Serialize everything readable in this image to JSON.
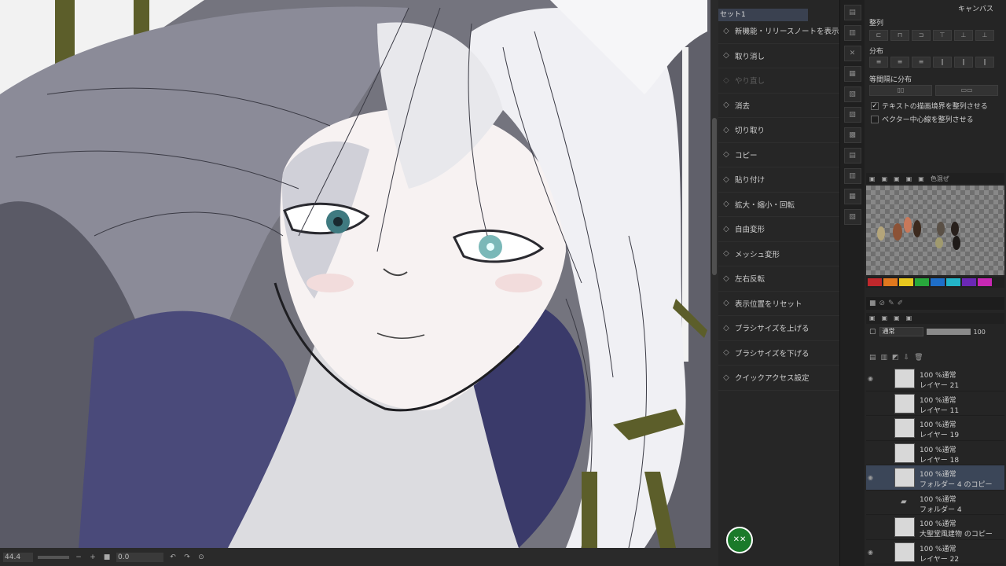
{
  "canvas": {
    "zoom": "44.4",
    "angle": "0.0"
  },
  "menu": {
    "set_tab": "セット1",
    "items": [
      {
        "label": "新機能・リリースノートを表示",
        "icon": "info-icon",
        "disabled": false
      },
      {
        "label": "取り消し",
        "icon": "undo-icon",
        "disabled": false
      },
      {
        "label": "やり直し",
        "icon": "redo-icon",
        "disabled": true
      },
      {
        "label": "消去",
        "icon": "clear-icon",
        "disabled": false
      },
      {
        "label": "切り取り",
        "icon": "cut-icon",
        "disabled": false
      },
      {
        "label": "コピー",
        "icon": "copy-icon",
        "disabled": false
      },
      {
        "label": "貼り付け",
        "icon": "paste-icon",
        "disabled": false
      },
      {
        "label": "拡大・縮小・回転",
        "icon": "transform-icon",
        "disabled": false
      },
      {
        "label": "自由変形",
        "icon": "free-transform-icon",
        "disabled": false
      },
      {
        "label": "メッシュ変形",
        "icon": "mesh-icon",
        "disabled": false
      },
      {
        "label": "左右反転",
        "icon": "flip-icon",
        "disabled": false
      },
      {
        "label": "表示位置をリセット",
        "icon": "reset-view-icon",
        "disabled": false
      },
      {
        "label": "ブラシサイズを上げる",
        "icon": "brush-up-icon",
        "disabled": false
      },
      {
        "label": "ブラシサイズを下げる",
        "icon": "brush-down-icon",
        "disabled": false
      },
      {
        "label": "クイックアクセス設定",
        "icon": "settings-icon",
        "disabled": false
      }
    ]
  },
  "right": {
    "canvas_label": "キャンバス",
    "align_label": "整列",
    "distribute_label": "分布",
    "equal_label": "等間隔に分布",
    "check1": "テキストの描画境界を整列させる",
    "check2": "ベクター中心線を整列させる",
    "palette_tab": "色混ぜ",
    "blend_mode": "通常",
    "opacity": "100"
  },
  "layers": [
    {
      "l1": "100 %通常",
      "l2": "レイヤー 21",
      "selected": false,
      "eye": true
    },
    {
      "l1": "100 %通常",
      "l2": "レイヤー 11",
      "selected": false,
      "eye": false
    },
    {
      "l1": "100 %通常",
      "l2": "レイヤー 19",
      "selected": false,
      "eye": false
    },
    {
      "l1": "100 %通常",
      "l2": "レイヤー 18",
      "selected": false,
      "eye": false
    },
    {
      "l1": "100 %通常",
      "l2": "フォルダー 4 のコピー",
      "selected": true,
      "eye": true
    },
    {
      "l1": "100 %通常",
      "l2": "フォルダー 4",
      "selected": false,
      "eye": false,
      "folder": true
    },
    {
      "l1": "100 %通常",
      "l2": "大聖堂風建物 のコピー",
      "selected": false,
      "eye": false
    },
    {
      "l1": "100 %通常",
      "l2": "レイヤー 22",
      "selected": false,
      "eye": true
    }
  ],
  "colors": {
    "accent": "#3b4658",
    "palette": [
      "#c0282c",
      "#e0781e",
      "#e8c81e",
      "#28a83c",
      "#1e6ec8",
      "#23b4c8",
      "#6a28b4",
      "#c828b4"
    ],
    "swatches": [
      "#b4a57a",
      "#8c5236",
      "#c8785a",
      "#3c2a1e",
      "#5a5046",
      "#28201c",
      "#a09a6e",
      "#1e1a18"
    ]
  }
}
